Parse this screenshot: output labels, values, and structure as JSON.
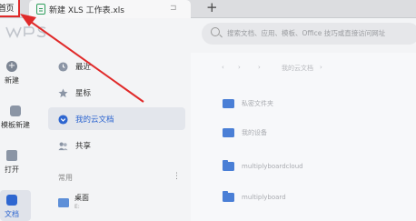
{
  "tabs": {
    "home": "首页",
    "doc": "新建 XLS 工作表.xls",
    "pin_icon": "pin-icon",
    "add": "+"
  },
  "header": {
    "logo": "WPS",
    "search_placeholder": "搜索文档、应用、模板、Office 技巧或直接访问网址"
  },
  "rail": {
    "items": [
      {
        "label": "新建",
        "icon": "plus-circle-icon"
      },
      {
        "label": "模板新建",
        "icon": "template-icon"
      },
      {
        "label": "打开",
        "icon": "folder-open-icon"
      },
      {
        "label": "文档",
        "icon": "document-icon"
      }
    ]
  },
  "nav": {
    "items": [
      {
        "label": "最近",
        "icon": "clock-icon"
      },
      {
        "label": "星标",
        "icon": "star-icon"
      },
      {
        "label": "我的云文档",
        "icon": "cloud-icon"
      },
      {
        "label": "共享",
        "icon": "people-icon"
      }
    ],
    "section": "常用",
    "pinned": {
      "label": "桌面",
      "sub": "E:"
    }
  },
  "main": {
    "breadcrumb": [
      "‹",
      "›",
      "我的云文档",
      "›"
    ],
    "files": [
      {
        "name": "私密文件夹",
        "icon": "lock-folder-icon"
      },
      {
        "name": "我的设备",
        "icon": "device-folder-icon"
      },
      {
        "name": "multiplyboardcloud",
        "icon": "folder-icon"
      },
      {
        "name": "multiplyboard",
        "icon": "folder-icon"
      }
    ]
  },
  "colors": {
    "accent": "#2e66d0",
    "annotation": "#e02a2a",
    "excel_green": "#2e9e5b"
  }
}
